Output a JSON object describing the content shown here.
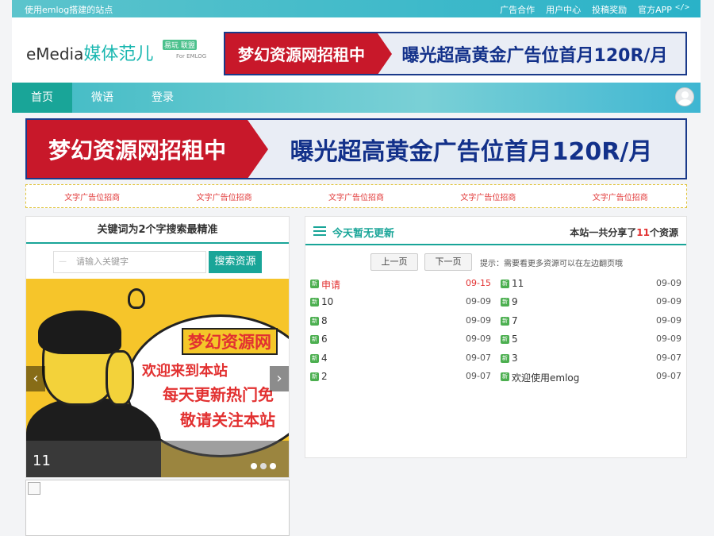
{
  "topbar": {
    "tagline": "使用emlog搭建的站点",
    "links": [
      "广告合作",
      "用户中心",
      "投稿奖励",
      "官方APP"
    ],
    "code_glyph": "</>"
  },
  "logo": {
    "en": "eMedia",
    "cn": "媒体范儿",
    "badge": "易玩 联盟",
    "badge_sub": "For EMLOG"
  },
  "banner": {
    "left_text": "梦幻资源网招租中",
    "right_text": "曝光超高黄金广告位首月120R/月"
  },
  "nav": {
    "items": [
      "首页",
      "微语",
      "登录"
    ],
    "active_index": 0
  },
  "text_ads": [
    "文字广告位招商",
    "文字广告位招商",
    "文字广告位招商",
    "文字广告位招商",
    "文字广告位招商"
  ],
  "search_panel": {
    "title": "关键词为2个字搜索最精准",
    "placeholder": "请输入关键字",
    "button": "搜索资源"
  },
  "slider": {
    "line1": "梦幻资源网",
    "line2": "欢迎来到本站",
    "line3": "每天更新热门免",
    "line4": "敬请关注本站",
    "caption": "11",
    "prev": "‹",
    "next": "›",
    "slide_count": 3,
    "active_slide": 1
  },
  "resources": {
    "title": "今天暂无更新",
    "count_prefix": "本站一共分享了",
    "count": "11",
    "count_suffix": "个资源",
    "prev_page": "上一页",
    "next_page": "下一页",
    "hint": "提示：需要看更多资源可以在左边翻页哦",
    "new_badge": "新",
    "items": [
      {
        "name": "申请",
        "date": "09-15",
        "hot": true
      },
      {
        "name": "11",
        "date": "09-09",
        "hot": false
      },
      {
        "name": "10",
        "date": "09-09",
        "hot": false
      },
      {
        "name": "9",
        "date": "09-09",
        "hot": false
      },
      {
        "name": "8",
        "date": "09-09",
        "hot": false
      },
      {
        "name": "7",
        "date": "09-09",
        "hot": false
      },
      {
        "name": "6",
        "date": "09-09",
        "hot": false
      },
      {
        "name": "5",
        "date": "09-09",
        "hot": false
      },
      {
        "name": "4",
        "date": "09-07",
        "hot": false
      },
      {
        "name": "3",
        "date": "09-07",
        "hot": false
      },
      {
        "name": "2",
        "date": "09-07",
        "hot": false
      },
      {
        "name": "欢迎使用emlog",
        "date": "09-07",
        "hot": false
      }
    ]
  },
  "icons": {
    "avatar": "user-avatar-icon",
    "list": "list-icon",
    "broken_image": "broken-image-icon"
  },
  "colors": {
    "accent": "#19a598",
    "topbar": "#2ab2c8",
    "hot": "#e23131",
    "banner_red": "#c8182a",
    "banner_blue": "#13318a"
  }
}
